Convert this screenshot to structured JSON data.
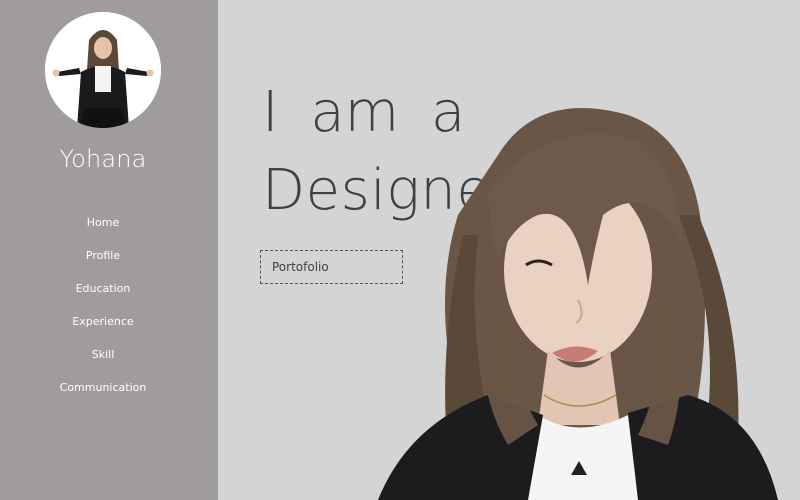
{
  "sidebar": {
    "name": "Yohana",
    "avatar_icon": "profile-photo",
    "nav": [
      {
        "label": "Home"
      },
      {
        "label": "Profile"
      },
      {
        "label": "Education"
      },
      {
        "label": "Experience"
      },
      {
        "label": "Skill"
      },
      {
        "label": "Communication"
      }
    ]
  },
  "hero": {
    "line1": "I am a",
    "line2": "Designer",
    "button_label": "Portofolio",
    "portrait_icon": "woman-portrait"
  },
  "colors": {
    "sidebar_bg": "#a09c9d",
    "main_bg": "#d4d4d4",
    "headline_text": "#3d4045",
    "sidebar_text": "#ffffff"
  }
}
